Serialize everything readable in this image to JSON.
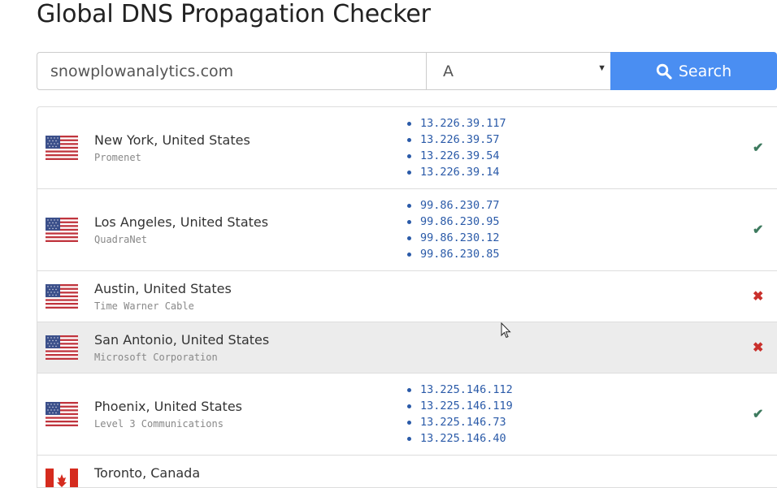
{
  "page": {
    "title": "Global DNS Propagation Checker"
  },
  "search": {
    "domain_value": "snowplowanalytics.com",
    "record_type": "A",
    "button_label": "Search"
  },
  "results": [
    {
      "location": "New York, United States",
      "isp": "Promenet",
      "flag": "us-flag-icon",
      "ips": [
        "13.226.39.117",
        "13.226.39.57",
        "13.226.39.54",
        "13.226.39.14"
      ],
      "status": "ok"
    },
    {
      "location": "Los Angeles, United States",
      "isp": "QuadraNet",
      "flag": "us-flag-icon",
      "ips": [
        "99.86.230.77",
        "99.86.230.95",
        "99.86.230.12",
        "99.86.230.85"
      ],
      "status": "ok"
    },
    {
      "location": "Austin, United States",
      "isp": "Time Warner Cable",
      "flag": "us-flag-icon",
      "ips": [],
      "status": "fail"
    },
    {
      "location": "San Antonio, United States",
      "isp": "Microsoft Corporation",
      "flag": "us-flag-icon",
      "ips": [],
      "status": "fail"
    },
    {
      "location": "Phoenix, United States",
      "isp": "Level 3 Communications",
      "flag": "us-flag-icon",
      "ips": [
        "13.225.146.112",
        "13.225.146.119",
        "13.225.146.73",
        "13.225.146.40"
      ],
      "status": "ok"
    },
    {
      "location": "Toronto, Canada",
      "isp": "",
      "flag": "ca-flag-icon",
      "ips": [],
      "status": ""
    }
  ],
  "colors": {
    "accent": "#4a8ef2",
    "ok": "#3d7a5e",
    "fail": "#c9302c",
    "ip_text": "#2a5aa8"
  }
}
